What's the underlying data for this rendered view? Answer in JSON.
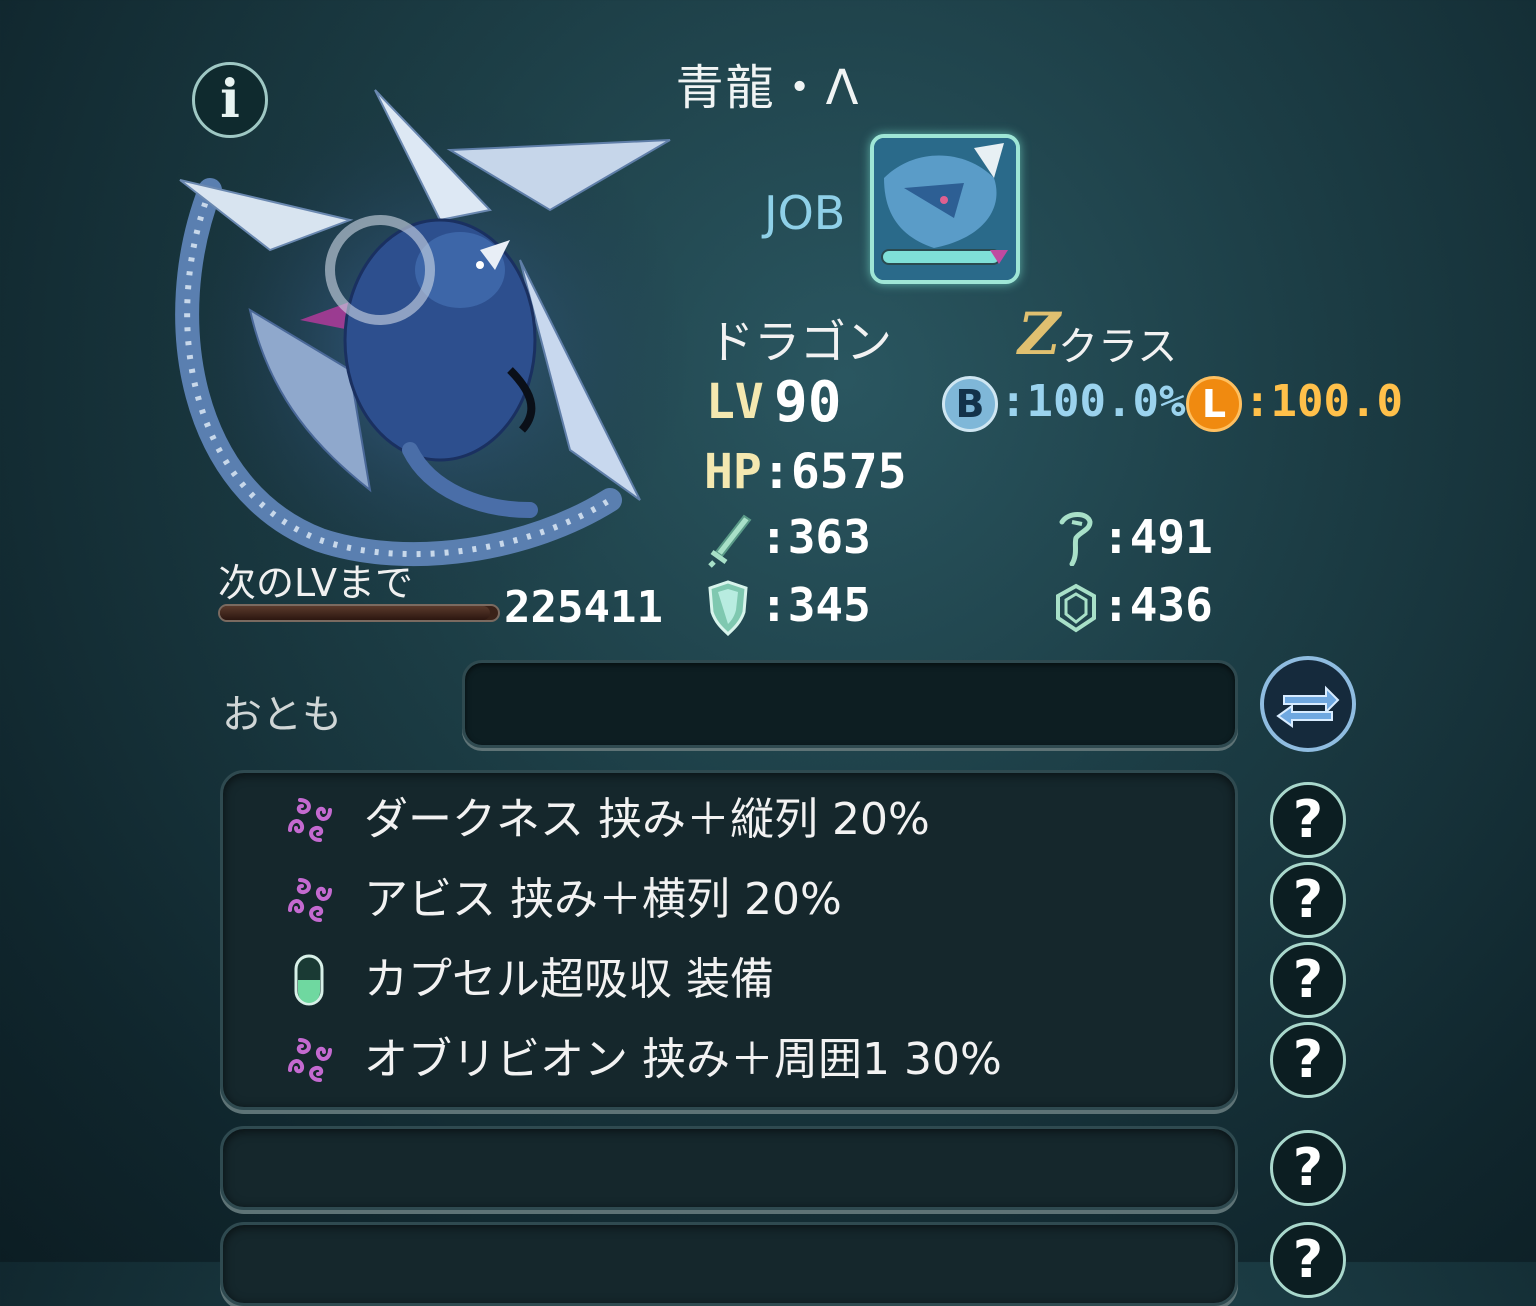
{
  "header": {
    "title": "青龍・Λ",
    "info_label": "i"
  },
  "job": {
    "label": "JOB"
  },
  "profile": {
    "race": "ドラゴン",
    "class_letter": "Z",
    "class_label": "クラス",
    "lv_label": "LV",
    "lv_value": "90",
    "hp_label": "HP",
    "hp_value": ":6575",
    "b_badge": "B",
    "b_value": ":100.0%",
    "l_badge": "L",
    "l_value": ":100.0",
    "attack": ":363",
    "magic": ":491",
    "defense": ":345",
    "magic_defense": ":436",
    "next_lv_label": "次のLVまで",
    "next_lv_value": "225411",
    "exp_progress": 0.97
  },
  "otomo": {
    "label": "おとも"
  },
  "abilities": [
    {
      "text": "ダークネス 挟み＋縦列 20%",
      "icon": "spiral-icon"
    },
    {
      "text": "アビス 挟み＋横列 20%",
      "icon": "spiral-icon"
    },
    {
      "text": "カプセル超吸収 装備",
      "icon": "capsule-icon"
    },
    {
      "text": "オブリビオン 挟み＋周囲1 30%",
      "icon": "spiral-icon"
    }
  ],
  "help_label": "?",
  "colors": {
    "accent_teal": "#9fe6d6",
    "class_gold": "#e0c070",
    "l_orange": "#f08a10",
    "spiral_purple": "#c46ad0"
  }
}
